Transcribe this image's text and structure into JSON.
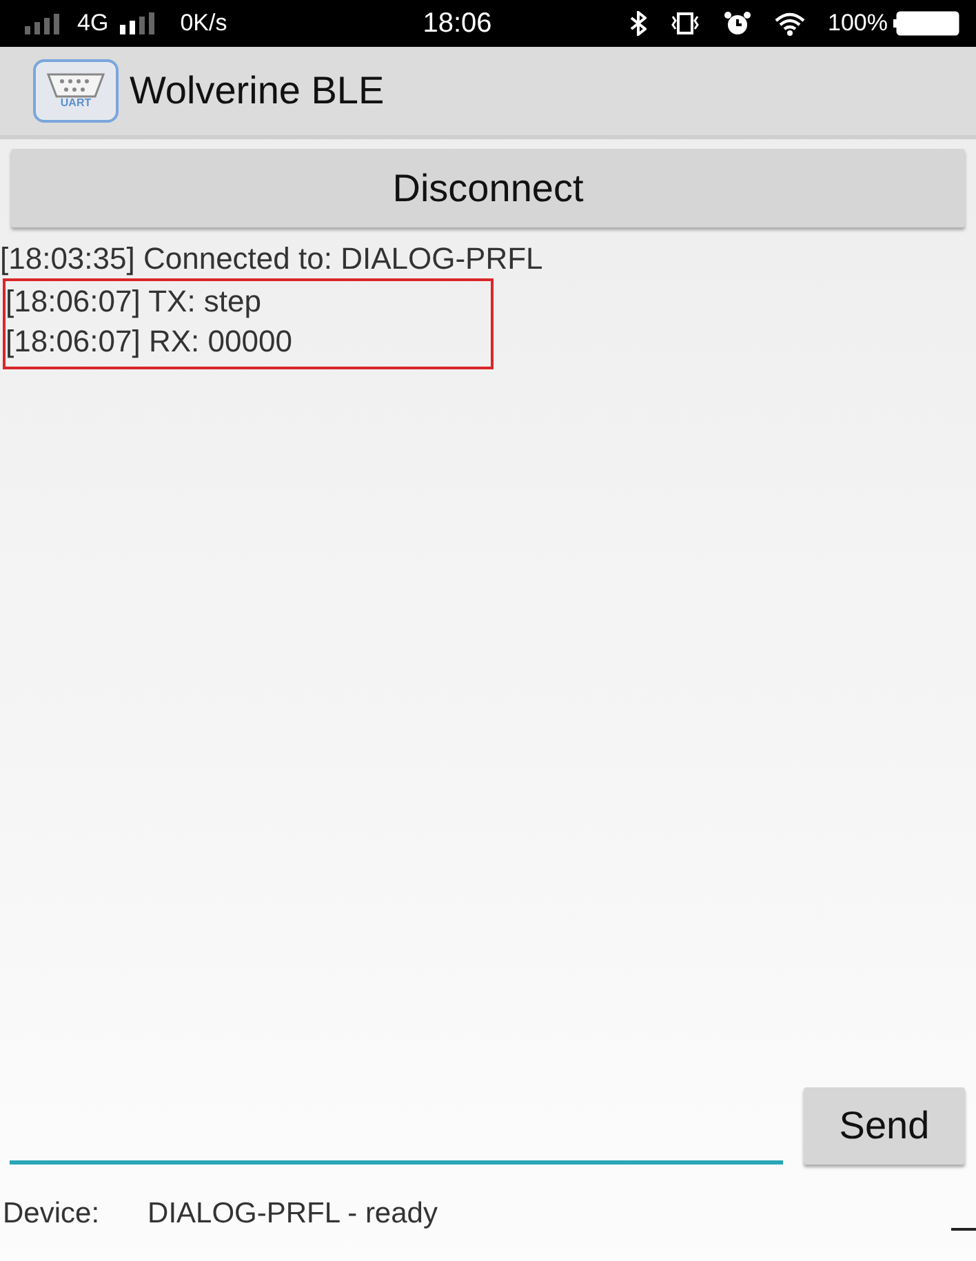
{
  "status_bar": {
    "network": "4G",
    "speed": "0K/s",
    "time": "18:06",
    "battery": "100%"
  },
  "app_bar": {
    "title": "Wolverine BLE",
    "icon_label": "UART"
  },
  "disconnect_button": "Disconnect",
  "log": [
    {
      "text": "[18:03:35] Connected to: DIALOG-PRFL",
      "highlighted": false
    },
    {
      "text": "[18:06:07] TX: step",
      "highlighted": true
    },
    {
      "text": "[18:06:07] RX: 00000",
      "highlighted": true
    }
  ],
  "send_button": "Send",
  "device": {
    "label": "Device:",
    "value": "DIALOG-PRFL - ready"
  }
}
